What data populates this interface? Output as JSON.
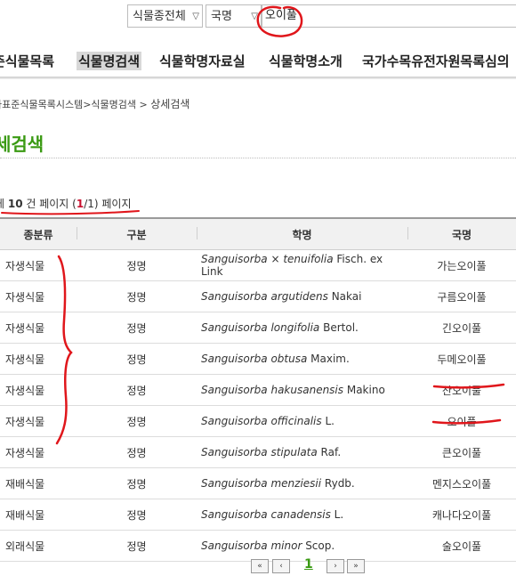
{
  "search": {
    "category_select": "식물종전체",
    "field_select": "국명",
    "query": "오이풀"
  },
  "nav": {
    "items": [
      "준식물목록",
      "식물명검색",
      "식물학명자료실",
      "식물학명소개",
      "국가수목유전자원목록심의"
    ],
    "active_index": 1
  },
  "breadcrumb": {
    "items": [
      "가표준식물목록시스템",
      "식물명검색",
      "상세검색"
    ],
    "separator": ">"
  },
  "page_title": "세검색",
  "summary": {
    "prefix": "체 ",
    "count": "10",
    "mid": " 건 페이지 (",
    "current": "1",
    "rest": "/1) 페이지"
  },
  "table": {
    "headers": [
      "종분류",
      "구분",
      "학명",
      "국명"
    ],
    "rows": [
      {
        "type": "자생식물",
        "status": "정명",
        "genus": "Sanguisorba",
        "mid": " × ",
        "epithet": "tenuifolia",
        "author": " Fisch. ex Link",
        "name": "가는오이풀"
      },
      {
        "type": "자생식물",
        "status": "정명",
        "genus": "Sanguisorba",
        "mid": " ",
        "epithet": "argutidens",
        "author": " Nakai",
        "name": "구름오이풀"
      },
      {
        "type": "자생식물",
        "status": "정명",
        "genus": "Sanguisorba",
        "mid": " ",
        "epithet": "longifolia",
        "author": " Bertol.",
        "name": "긴오이풀"
      },
      {
        "type": "자생식물",
        "status": "정명",
        "genus": "Sanguisorba",
        "mid": " ",
        "epithet": "obtusa",
        "author": " Maxim.",
        "name": "두메오이풀"
      },
      {
        "type": "자생식물",
        "status": "정명",
        "genus": "Sanguisorba",
        "mid": " ",
        "epithet": "hakusanensis",
        "author": " Makino",
        "name": "산오이풀"
      },
      {
        "type": "자생식물",
        "status": "정명",
        "genus": "Sanguisorba",
        "mid": " ",
        "epithet": "officinalis",
        "author": " L.",
        "name": "오이풀"
      },
      {
        "type": "자생식물",
        "status": "정명",
        "genus": "Sanguisorba",
        "mid": " ",
        "epithet": "stipulata",
        "author": " Raf.",
        "name": "큰오이풀"
      },
      {
        "type": "재배식물",
        "status": "정명",
        "genus": "Sanguisorba",
        "mid": " ",
        "epithet": "menziesii",
        "author": " Rydb.",
        "name": "멘지스오이풀"
      },
      {
        "type": "재배식물",
        "status": "정명",
        "genus": "Sanguisorba",
        "mid": " ",
        "epithet": "canadensis",
        "author": " L.",
        "name": "캐나다오이풀"
      },
      {
        "type": "외래식물",
        "status": "정명",
        "genus": "Sanguisorba",
        "mid": " ",
        "epithet": "minor",
        "author": " Scop.",
        "name": "술오이풀"
      }
    ]
  },
  "pager": {
    "first": "«",
    "prev": "‹",
    "page": "1",
    "next": "›",
    "last": "»"
  },
  "colors": {
    "accent_green": "#3a9a13",
    "annotation_red": "#e0161b"
  }
}
